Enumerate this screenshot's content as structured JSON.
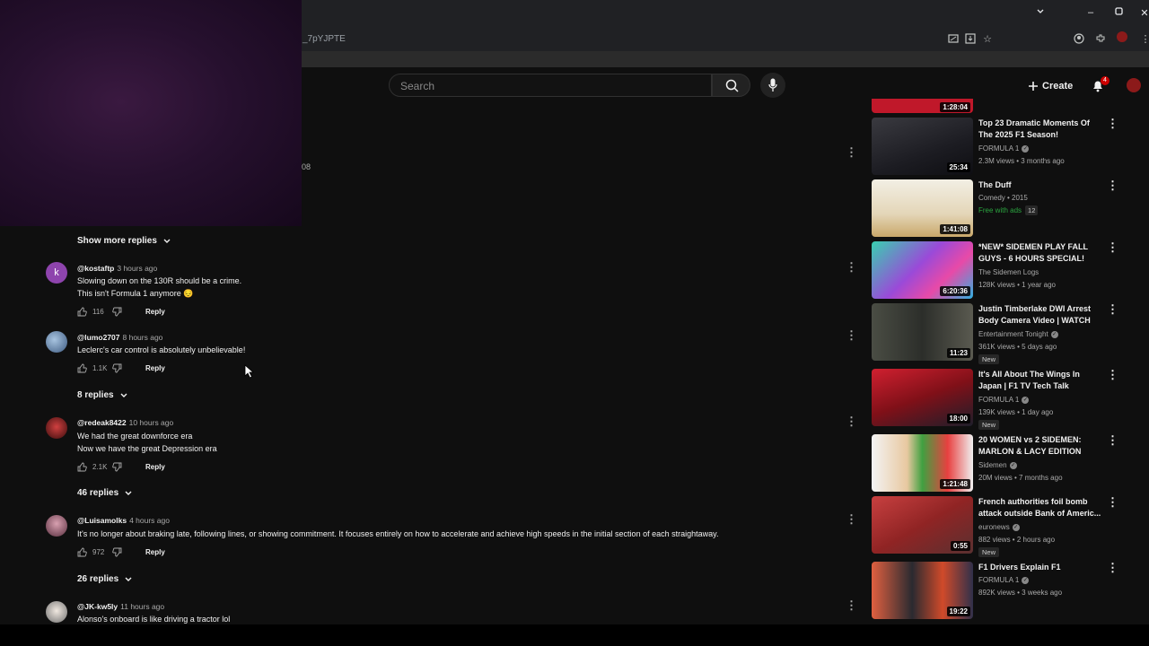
{
  "browser": {
    "url_fragment": "_7pYJPTE"
  },
  "header": {
    "search_placeholder": "Search",
    "create_label": "Create",
    "notification_count": "4"
  },
  "stray_text": "08",
  "comments_section": {
    "show_more_label": "Show more replies",
    "comments": [
      {
        "user": "@kostaftp",
        "time": "3 hours ago",
        "lines": [
          "Slowing down on the 130R should be a crime.",
          "This isn't Formula 1 anymore 😔"
        ],
        "likes": "116",
        "reply_label": "Reply",
        "avatar_letter": "k",
        "avatar_color": "#8e44ad"
      },
      {
        "user": "@lumo2707",
        "time": "8 hours ago",
        "lines": [
          "Leclerc's car control is absolutely unbelievable!"
        ],
        "likes": "1.1K",
        "reply_label": "Reply",
        "replies_label": "8 replies",
        "avatar_color": "#5d7a9c"
      },
      {
        "user": "@redeak8422",
        "time": "10 hours ago",
        "lines": [
          "We had the great downforce era",
          "Now we have the great Depression era"
        ],
        "likes": "2.1K",
        "reply_label": "Reply",
        "replies_label": "46 replies",
        "avatar_color": "#7a2626"
      },
      {
        "user": "@Luisamolks",
        "time": "4 hours ago",
        "lines": [
          "It's no longer about braking late, following lines, or showing commitment. It focuses entirely on how to accelerate and achieve high speeds in the initial section of each straightaway."
        ],
        "likes": "972",
        "reply_label": "Reply",
        "replies_label": "26 replies",
        "avatar_color": "#9c6b7a"
      },
      {
        "user": "@JK-kw5ly",
        "time": "11 hours ago",
        "lines": [
          "Alonso's onboard is like driving a tractor lol"
        ],
        "avatar_color": "#d8d8d8"
      }
    ]
  },
  "sidebar_videos": [
    {
      "title": "",
      "duration": "1:28:04",
      "thumb_color": "#c0182a"
    },
    {
      "title": "Top 23 Dramatic Moments Of The 2025 F1 Season!",
      "channel": "FORMULA 1",
      "verified": true,
      "meta": "2.3M views • 3 months ago",
      "duration": "25:34",
      "thumb_color": "#2a2a2e"
    },
    {
      "title": "The Duff",
      "channel": "Comedy • 2015",
      "free_label": "Free with ads",
      "free_count": "12",
      "duration": "1:41:08",
      "thumb_color": "#e8e0c8"
    },
    {
      "title": "*NEW* SIDEMEN PLAY FALL GUYS - 6 HOURS SPECIAL!",
      "channel": "The Sidemen Logs",
      "meta": "128K views • 1 year ago",
      "duration": "6:20:36",
      "thumb_color": "#35c0a0"
    },
    {
      "title": "Justin Timberlake DWI Arrest Body Camera Video | WATCH",
      "channel": "Entertainment Tonight",
      "verified": true,
      "meta": "361K views • 5 days ago",
      "badge": "New",
      "duration": "11:23",
      "thumb_color": "#3d4038"
    },
    {
      "title": "It's All About The Wings In Japan | F1 TV Tech Talk",
      "channel": "FORMULA 1",
      "verified": true,
      "meta": "139K views • 1 day ago",
      "badge": "New",
      "duration": "18:00",
      "thumb_color": "#b01828"
    },
    {
      "title": "20 WOMEN vs 2 SIDEMEN: MARLON & LACY EDITION",
      "channel": "Sidemen",
      "verified": true,
      "meta": "20M views • 7 months ago",
      "duration": "1:21:48",
      "thumb_color": "#f0f0f0"
    },
    {
      "title": "French authorities foil bomb attack outside Bank of Americ...",
      "channel": "euronews",
      "verified": true,
      "meta": "882 views • 2 hours ago",
      "badge": "New",
      "duration": "0:55",
      "thumb_color": "#a82a2a"
    },
    {
      "title": "F1 Drivers Explain F1",
      "channel": "FORMULA 1",
      "verified": true,
      "meta": "892K views • 3 weeks ago",
      "duration": "19:22",
      "thumb_color": "#c44a30"
    }
  ]
}
